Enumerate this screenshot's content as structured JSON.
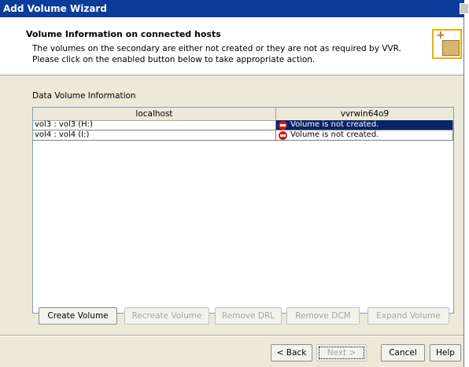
{
  "window": {
    "title": "Add Volume Wizard"
  },
  "header": {
    "heading": "Volume Information on connected hosts",
    "description": "The volumes on the secondary are either not created or they are not as required by VVR. Please click on the enabled button below to take appropriate action.",
    "logo_icon": "add-volume-box-icon"
  },
  "section_label": "Data Volume Information",
  "table": {
    "columns": [
      "localhost",
      "vvrwin64o9"
    ],
    "rows": [
      {
        "local": "vol3 : vol3 (H:)",
        "status": "Volume is not created.",
        "status_icon": "error-stop-icon",
        "selected": true
      },
      {
        "local": "vol4 : vol4 (I:)",
        "status": "Volume is not created.",
        "status_icon": "error-stop-icon",
        "selected": false
      }
    ]
  },
  "actions": {
    "create": "Create Volume",
    "recreate": "Recreate Volume",
    "remove_drl": "Remove DRL",
    "remove_dcm": "Remove DCM",
    "expand": "Expand Volume"
  },
  "footer": {
    "back": "< Back",
    "next": "Next >",
    "cancel": "Cancel",
    "help": "Help"
  },
  "colors": {
    "titlebar": "#0b3c9c",
    "selection": "#0a246a",
    "error": "#d41c1c",
    "logo_border": "#f0b000"
  }
}
